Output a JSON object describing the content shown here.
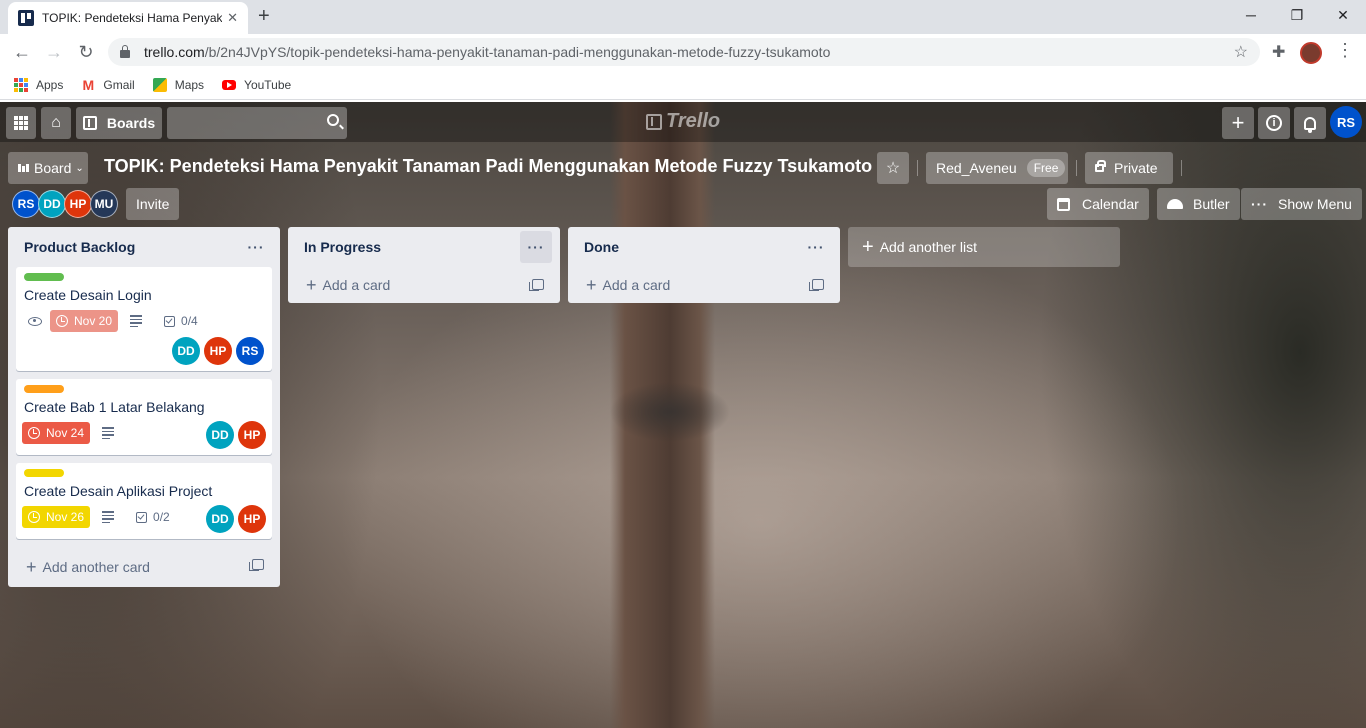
{
  "browser": {
    "tab_title": "TOPIK: Pendeteksi Hama Penyakit",
    "tab_close": "✕",
    "new_tab": "+",
    "url_host": "trello.com",
    "url_path": "/b/2n4JVpYS/topik-pendeteksi-hama-penyakit-tanaman-padi-menggunakan-metode-fuzzy-tsukamoto",
    "bookmarks": [
      {
        "label": "Apps",
        "icon": "apps-grid-icon"
      },
      {
        "label": "Gmail",
        "icon": "gmail-icon"
      },
      {
        "label": "Maps",
        "icon": "maps-icon"
      },
      {
        "label": "YouTube",
        "icon": "youtube-icon"
      }
    ]
  },
  "nav": {
    "boards_label": "Boards",
    "logo_text": "Trello",
    "user_initials": "RS"
  },
  "board": {
    "switcher_label": "Board",
    "title": "TOPIK: Pendeteksi Hama Penyakit Tanaman Padi Menggunakan Metode Fuzzy Tsukamoto",
    "team_name": "Red_Aveneu",
    "team_badge": "Free",
    "visibility": "Private",
    "invite_label": "Invite",
    "calendar_label": "Calendar",
    "butler_label": "Butler",
    "show_menu_label": "Show Menu",
    "members": [
      {
        "initials": "RS",
        "color": "#0052cc"
      },
      {
        "initials": "DD",
        "color": "#00a3bf"
      },
      {
        "initials": "HP",
        "color": "#de350b"
      },
      {
        "initials": "MU",
        "color": "#253858"
      }
    ]
  },
  "colors": {
    "label_green": "#61bd4f",
    "label_orange": "#ff9f1a",
    "label_yellow": "#f2d600",
    "due_soon_red": "#ec9488",
    "overdue_red": "#eb5a46",
    "due_yellow": "#f2d600"
  },
  "lists": [
    {
      "name": "Product Backlog",
      "add_label": "Add another card",
      "cards": [
        {
          "title": "Create Desain Login",
          "due": "Nov 20",
          "checklist": "0/4",
          "members": [
            "DD",
            "HP",
            "RS"
          ]
        },
        {
          "title": "Create Bab 1 Latar Belakang",
          "due": "Nov 24",
          "members": [
            "DD",
            "HP"
          ]
        },
        {
          "title": "Create Desain Aplikasi Project",
          "due": "Nov 26",
          "checklist": "0/2",
          "members": [
            "DD",
            "HP"
          ]
        }
      ]
    },
    {
      "name": "In Progress",
      "add_label": "Add a card",
      "cards": []
    },
    {
      "name": "Done",
      "add_label": "Add a card",
      "cards": []
    }
  ],
  "add_list_label": "Add another list"
}
